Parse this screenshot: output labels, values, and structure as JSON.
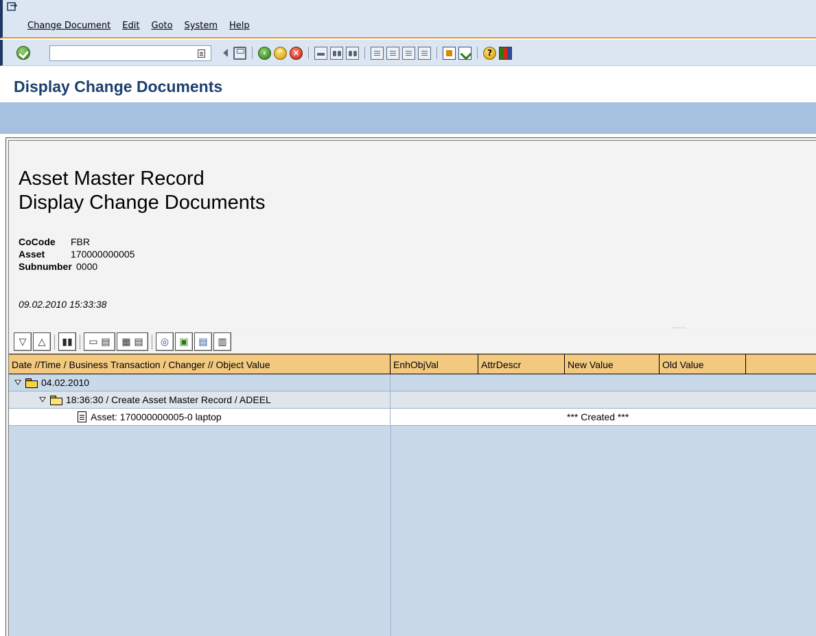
{
  "menu": {
    "items": [
      {
        "label": "Change Document"
      },
      {
        "label": "Edit"
      },
      {
        "label": "Goto"
      },
      {
        "label": "System"
      },
      {
        "label": "Help"
      }
    ]
  },
  "toolbar": {
    "command_value": "",
    "icons": [
      "enter-icon",
      "dropdown-icon",
      "back-arrow-icon",
      "save-icon",
      "back-icon",
      "exit-icon",
      "cancel-icon",
      "print-icon",
      "find-icon",
      "find-next-icon",
      "first-page-icon",
      "previous-page-icon",
      "next-page-icon",
      "last-page-icon",
      "create-session-icon",
      "create-shortcut-icon",
      "help-icon",
      "customize-layout-icon"
    ]
  },
  "title": "Display Change Documents",
  "header": {
    "line1": "Asset Master Record",
    "line2": "Display Change Documents",
    "fields": [
      {
        "key": "CoCode",
        "value": "FBR"
      },
      {
        "key": "Asset",
        "value": "170000000005"
      },
      {
        "key": "Subnumber",
        "value": "0000"
      }
    ],
    "timestamp": "09.02.2010 15:33:38",
    "splitter": "....."
  },
  "alv_toolbar": {
    "icons": [
      "expand-icon",
      "collapse-icon",
      "find-icon",
      "print-preview-icon",
      "layout-icon",
      "zoom-icon",
      "export-icon",
      "details-icon",
      "column-icon"
    ]
  },
  "grid": {
    "columns": [
      "Date //Time / Business Transaction / Changer // Object Value",
      "EnhObjVal",
      "AttrDescr",
      "New Value",
      "Old Value"
    ],
    "rows": [
      {
        "level": 0,
        "text": "04.02.2010",
        "icon": "open-folder-icon"
      },
      {
        "level": 1,
        "text": "18:36:30 / Create Asset Master Record / ADEEL",
        "icon": "folder-icon"
      },
      {
        "level": 2,
        "text": "Asset: 170000000005-0 laptop",
        "icon": "document-icon",
        "new_value": "*** Created ***"
      }
    ]
  },
  "colors": {
    "menu_bg": "#dce6f2",
    "accent_line": "#e2962c",
    "title_color": "#1c3f6f",
    "app_toolbar_bg": "#a6c1e0",
    "grid_header_bg": "#f3c980",
    "grid_bg": "#c9d9ea"
  }
}
